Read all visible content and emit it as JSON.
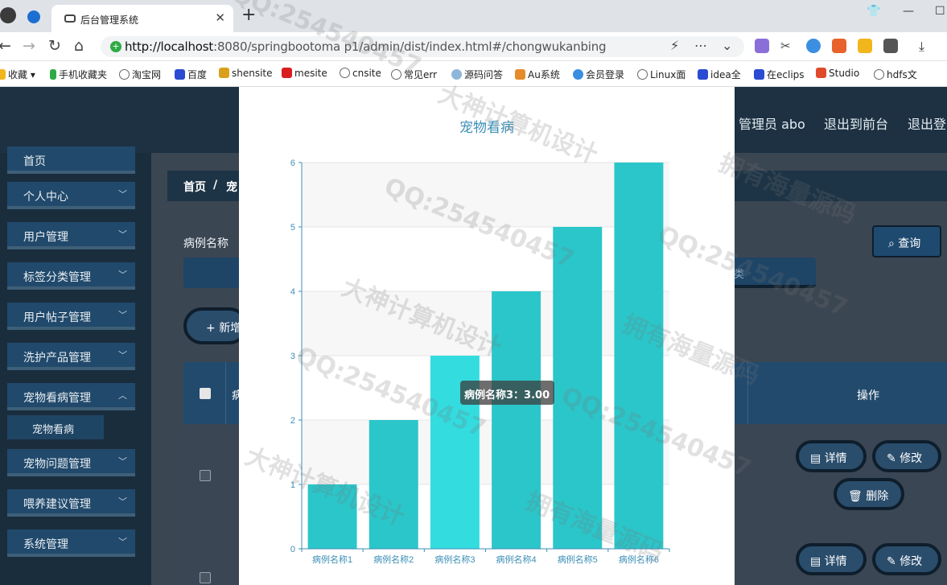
{
  "browser": {
    "tab_title": "后台管理系统",
    "url_host": "http://localhost",
    "url_rest": ":8080/springbootoma p1/admin/dist/index.html#/chongwukanbing",
    "bookmarks": [
      "收藏",
      "手机收藏夹",
      "淘宝网",
      "百度",
      "shensite",
      "mesite",
      "cnsite",
      "常见err",
      "源码问答",
      "Au系统",
      "会员登录",
      "Linux面",
      "idea全",
      "在eclips",
      "Studio",
      "hdfs文"
    ]
  },
  "header": {
    "admin_label": "管理员 abo",
    "back_label": "退出到前台",
    "logout_label": "退出登"
  },
  "sidebar": {
    "items": [
      {
        "label": "首页"
      },
      {
        "label": "个人中心"
      },
      {
        "label": "用户管理"
      },
      {
        "label": "标签分类管理"
      },
      {
        "label": "用户帖子管理"
      },
      {
        "label": "洗护产品管理"
      },
      {
        "label": "宠物看病管理"
      },
      {
        "label": "宠物问题管理"
      },
      {
        "label": "喂养建议管理"
      },
      {
        "label": "系统管理"
      }
    ],
    "sub_item": "宠物看病"
  },
  "main": {
    "breadcrumb_home": "首页",
    "breadcrumb_sep": "/",
    "breadcrumb_current": "宠",
    "search_label": "病例名称",
    "select_placeholder": "类",
    "query_label": "查询",
    "add_label": "新增",
    "table_header_partial": "病",
    "ops_header": "操作",
    "detail_label": "详情",
    "edit_label": "修改",
    "delete_label": "删除"
  },
  "modal": {
    "tooltip": "病例名称3：3.00"
  },
  "chart_data": {
    "type": "bar",
    "title": "宠物看病",
    "categories": [
      "病例名称1",
      "病例名称2",
      "病例名称3",
      "病例名称4",
      "病例名称5",
      "病例名称6"
    ],
    "values": [
      1,
      2,
      3,
      4,
      5,
      6
    ],
    "ylim": [
      0,
      6
    ],
    "yticks": [
      0,
      1,
      2,
      3,
      4,
      5,
      6
    ],
    "grid": true,
    "bar_color": "#2bc6c9",
    "highlight_color": "#33dcdf",
    "highlight_index": 2
  },
  "watermarks": [
    "QQ:254540457",
    "大神计算机设计",
    "拥有海量源码"
  ]
}
